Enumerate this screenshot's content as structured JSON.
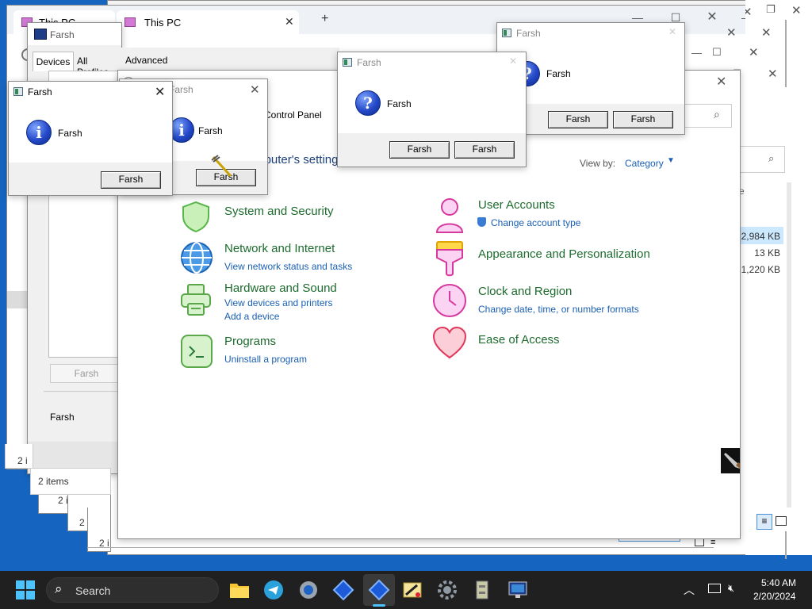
{
  "tabs": [
    {
      "label": "This PC"
    },
    {
      "label": "This PC"
    }
  ],
  "dialog_title": "Farsh",
  "dialog_message": "Farsh",
  "button_label": "Farsh",
  "printer_tabs": [
    "Devices",
    "All Profiles",
    "Advanced"
  ],
  "control_panel": {
    "breadcrumb": "Control Panel",
    "heading": "Adjust your computer's settings",
    "view_by_label": "View by:",
    "view_by_value": "Category",
    "categories": [
      {
        "title": "System and Security",
        "links": []
      },
      {
        "title": "Network and Internet",
        "links": [
          "View network status and tasks"
        ]
      },
      {
        "title": "Hardware and Sound",
        "links": [
          "View devices and printers",
          "Add a device"
        ]
      },
      {
        "title": "Programs",
        "links": [
          "Uninstall a program"
        ]
      },
      {
        "title": "User Accounts",
        "links": [
          "Change account type"
        ]
      },
      {
        "title": "Appearance and Personalization",
        "links": []
      },
      {
        "title": "Clock and Region",
        "links": [
          "Change date, time, or number formats"
        ]
      },
      {
        "title": "Ease of Access",
        "links": []
      }
    ]
  },
  "explorer": {
    "status": "2 items",
    "status_partial": "2 i",
    "sizes": [
      "12,984 KB",
      "13 KB",
      "1,220 KB"
    ]
  },
  "taskbar": {
    "search_placeholder": "Search",
    "time": "5:40 AM",
    "date": "2/20/2024"
  },
  "colors": {
    "taskbar_bg": "#202020",
    "desktop_bg": "#1565c0",
    "link": "#1a5fb4",
    "category_green": "#1d6b2e",
    "category_pink": "#2a7a3b"
  }
}
